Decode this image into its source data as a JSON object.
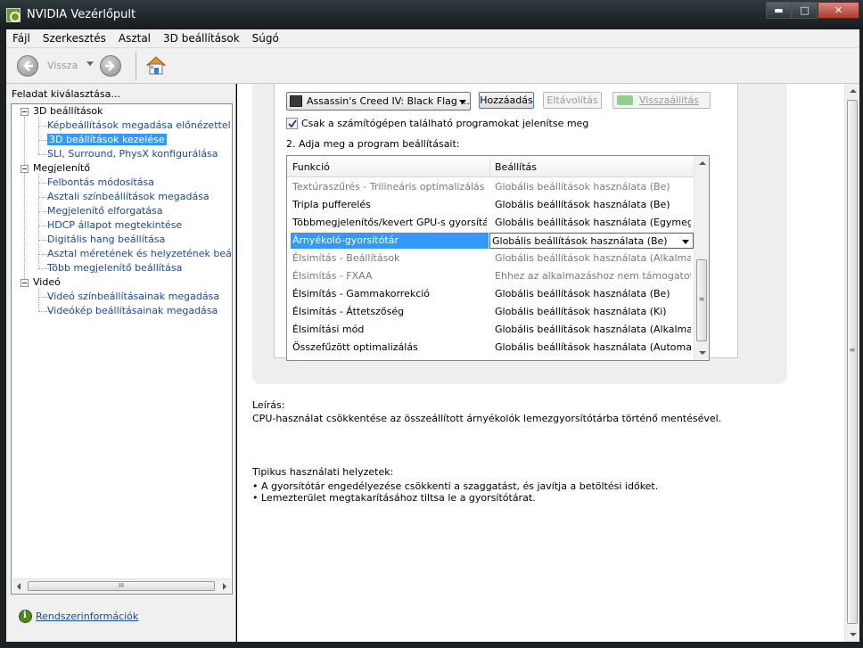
{
  "window": {
    "title": "NVIDIA Vezérlőpult",
    "buttons": {
      "minimize": "▬",
      "maximize": "□",
      "close": "✕"
    }
  },
  "menu": [
    "Fájl",
    "Szerkesztés",
    "Asztal",
    "3D beállítások",
    "Súgó"
  ],
  "toolbar": {
    "back_label": "Vissza"
  },
  "sidebar": {
    "heading": "Feladat kiválasztása...",
    "tree": [
      {
        "label": "3D beállítások",
        "children": [
          {
            "label": "Képbeállítások megadása előnézettel"
          },
          {
            "label": "3D beállítások kezelése",
            "selected": true
          },
          {
            "label": "SLI, Surround, PhysX konfigurálása"
          }
        ]
      },
      {
        "label": "Megjelenítő",
        "children": [
          {
            "label": "Felbontás módosítása"
          },
          {
            "label": "Asztali színbeállítások megadása"
          },
          {
            "label": "Megjelenítő elforgatása"
          },
          {
            "label": "HDCP állapot megtekintése"
          },
          {
            "label": "Digitális hang beállítása"
          },
          {
            "label": "Asztal méretének és helyzetének beállítása"
          },
          {
            "label": "Több megjelenítő beállítása"
          }
        ]
      },
      {
        "label": "Videó",
        "children": [
          {
            "label": "Videó színbeállításainak megadása"
          },
          {
            "label": "Videókép beállításainak megadása"
          }
        ]
      }
    ],
    "hscroll_grip": "III",
    "sysinfo_link": "Rendszerinformációk"
  },
  "program": {
    "selected": "Assassin's Creed IV: Black Flag ...",
    "add_button": "Hozzáadás",
    "remove_button": "Eltávolítás",
    "restore_button": "Visszaállítás",
    "checkbox_label": "Csak a számítógépen található programokat jelenítse meg",
    "checkbox_checked": true,
    "step2_label": "2. Adja meg a program beállításait:"
  },
  "settings_grid": {
    "headers": [
      "Funkció",
      "Beállítás"
    ],
    "rows": [
      {
        "feature": "Textúraszűrés - Trilineáris optimalizálás",
        "setting": "Globális beállítások használata (Be)",
        "dim": true
      },
      {
        "feature": "Tripla pufferelés",
        "setting": "Globális beállítások használata (Be)"
      },
      {
        "feature": "Többmegjelenítős/kevert GPU-s gyorsítás",
        "setting": "Globális beállítások használata (Egymegjel..."
      },
      {
        "feature": "Árnyékoló-gyorsítótár",
        "setting": "Globális beállítások használata (Be)",
        "selected": true
      },
      {
        "feature": "Élsimítás - Beállítások",
        "setting": "Globális beállítások használata (Alkalmazás...",
        "dim": true
      },
      {
        "feature": "Élsimítás - FXAA",
        "setting": "Ehhez az alkalmazáshoz nem támogatott",
        "dim": true
      },
      {
        "feature": "Élsimítás - Gammakorrekció",
        "setting": "Globális beállítások használata (Be)"
      },
      {
        "feature": "Élsimítás - Áttetszőség",
        "setting": "Globális beállítások használata (Ki)"
      },
      {
        "feature": "Élsimítási mód",
        "setting": "Globális beállítások használata (Alkalmazás..."
      },
      {
        "feature": "Összefűzött optimalizálás",
        "setting": "Globális beállítások használata (Automatikus)"
      }
    ],
    "vscroll_grip": "≡"
  },
  "description": {
    "title": "Leírás:",
    "text": "CPU-használat csökkentése az összeállított árnyékolók lemezgyorsítótárba történő mentésével.",
    "typical_title": "Tipikus használati helyzetek:",
    "bullets": [
      "• A gyorsítótár engedélyezése csökkenti a szaggatást, és javítja a betöltési időket.",
      "• Lemezterület megtakarításához tiltsa le a gyorsítótárat."
    ]
  },
  "main_vscroll_grip": "≡",
  "colors": {
    "selection": "#3399ff",
    "link": "#1a4a9a",
    "nvidia_green": "#6a9a2a"
  }
}
